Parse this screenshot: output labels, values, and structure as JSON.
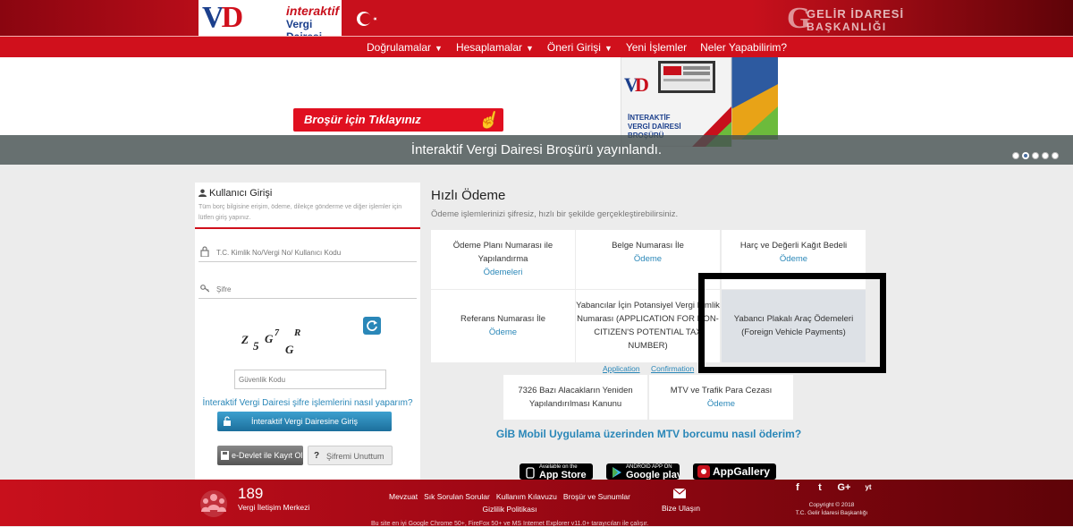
{
  "header": {
    "logo_text1": "interaktif",
    "logo_text2": "Vergi Dairesi",
    "gib_line1": "GELİR İDARESİ",
    "gib_line2": "BAŞKANLIĞI"
  },
  "nav": {
    "items": [
      {
        "label": "Doğrulamalar",
        "dropdown": true
      },
      {
        "label": "Hesaplamalar",
        "dropdown": true
      },
      {
        "label": "Öneri Girişi",
        "dropdown": true
      },
      {
        "label": "Yeni İşlemler",
        "dropdown": false
      },
      {
        "label": "Neler Yapabilirim?",
        "dropdown": false
      }
    ],
    "caret": "▼"
  },
  "banner": {
    "button_label": "Broşür için Tıklayınız",
    "caption": "İnteraktif Vergi Dairesi Broşürü yayınlandı.",
    "brochure_line1": "İNTERAKTİF",
    "brochure_line2": "VERGİ DAİRESİ",
    "brochure_line3": "BROŞÜRÜ",
    "slide_count": 5,
    "active_slide": 2
  },
  "login": {
    "title": "Kullanıcı Girişi",
    "description": "Tüm borç bilgisine erişim, ödeme, dilekçe gönderme ve diğer işlemler için lütfen giriş yapınız.",
    "id_placeholder": "T.C. Kimlik No/Vergi No/ Kullanıcı Kodu",
    "password_placeholder": "Şifre",
    "captcha_chars": [
      "Z",
      "5",
      "G",
      "7",
      "G",
      "R"
    ],
    "security_placeholder": "Güvenlik Kodu",
    "help_link": "İnteraktif Vergi Dairesi şifre işlemlerini nasıl yaparım?",
    "login_button": "İnteraktif Vergi Dairesine Giriş",
    "edevlet_button": "e-Devlet ile Kayıt Ol",
    "forgot_button": "Şifremi Unuttum"
  },
  "quick_payment": {
    "title": "Hızlı Ödeme",
    "subtitle": "Ödeme işlemlerinizi şifresiz, hızlı bir şekilde gerçekleştirebilirsiniz.",
    "cards": [
      {
        "text": "Ödeme Planı Numarası ile Yapılandırma",
        "link": "Ödemeleri"
      },
      {
        "text": "Belge Numarası İle",
        "link": "Ödeme"
      },
      {
        "text": "Harç ve Değerli Kağıt Bedeli",
        "link": "Ödeme"
      },
      {
        "text": "Referans Numarası İle",
        "link": "Ödeme"
      },
      {
        "text": "Yabancılar İçin Potansiyel Vergi Kimlik Numarası (APPLICATION FOR NON-CITIZEN'S POTENTIAL TAX NUMBER)",
        "link": ""
      },
      {
        "text": "Yabancı Plakalı Araç Ödemeleri (Foreign Vehicle Payments)",
        "link": ""
      },
      {
        "text": "7326 Bazı Alacakların Yeniden Yapılandırılması Kanunu",
        "link": ""
      },
      {
        "text": "MTV ve Trafik Para Cezası",
        "link": "Ödeme"
      }
    ],
    "sub_links": [
      "Application",
      "Confirmation"
    ],
    "mobile_link": "GİB Mobil Uygulama üzerinden MTV borcumu nasıl öderim?",
    "stores": [
      {
        "small": "Available on the",
        "big": "App Store"
      },
      {
        "small": "ANDROID APP ON",
        "big": "Google play"
      },
      {
        "small": "",
        "big": "AppGallery"
      }
    ]
  },
  "footer": {
    "call_number": "189",
    "call_label": "Vergi İletişim Merkezi",
    "links": [
      "Mevzuat",
      "Sık Sorulan Sorular",
      "Kullanım Kılavuzu",
      "Broşür ve Sunumlar",
      "Gizlilik Politikası"
    ],
    "browser_note": "Bu site en iyi Google Chrome 50+, FireFox 50+ ve MS Internet Explorer v11.0+ tarayıcıları ile çalışır.",
    "contact_label": "Bize Ulaşın",
    "socials": [
      "f",
      "t",
      "G+",
      "yt"
    ],
    "copyright_line1": "Copyright © 2018",
    "copyright_line2": "T.C. Gelir İdaresi Başkanlığı"
  },
  "colors": {
    "brand_red": "#d0101c",
    "link_blue": "#2a87b8",
    "highlight_border": "#000000"
  }
}
